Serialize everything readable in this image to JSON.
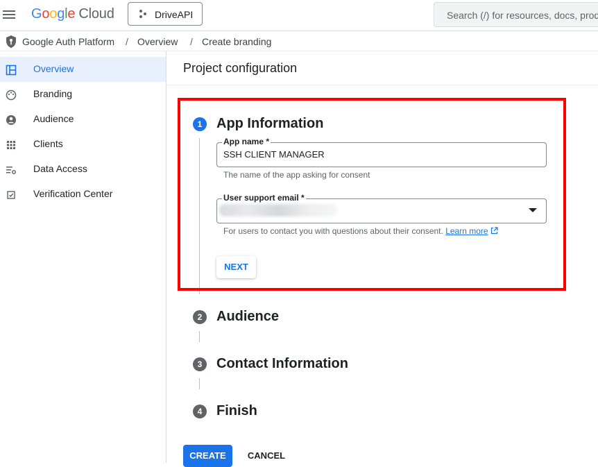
{
  "header": {
    "logo_google": [
      "G",
      "o",
      "o",
      "g",
      "l",
      "e"
    ],
    "logo_cloud": "Cloud",
    "project_name": "DriveAPI",
    "search_placeholder": "Search (/) for resources, docs, products"
  },
  "breadcrumb": [
    "Google Auth Platform",
    "Overview",
    "Create branding"
  ],
  "sidebar": {
    "items": [
      {
        "label": "Overview",
        "icon": "dashboard-icon",
        "active": true
      },
      {
        "label": "Branding",
        "icon": "palette-icon",
        "active": false
      },
      {
        "label": "Audience",
        "icon": "person-icon",
        "active": false
      },
      {
        "label": "Clients",
        "icon": "grid-icon",
        "active": false
      },
      {
        "label": "Data Access",
        "icon": "list-settings-icon",
        "active": false
      },
      {
        "label": "Verification Center",
        "icon": "checkbox-icon",
        "active": false
      }
    ]
  },
  "main": {
    "title": "Project configuration",
    "steps": [
      {
        "number": "1",
        "title": "App Information"
      },
      {
        "number": "2",
        "title": "Audience"
      },
      {
        "number": "3",
        "title": "Contact Information"
      },
      {
        "number": "4",
        "title": "Finish"
      }
    ],
    "app_name": {
      "label": "App name *",
      "value": "SSH CLIENT MANAGER",
      "hint": "The name of the app asking for consent"
    },
    "support_email": {
      "label": "User support email *",
      "hint": "For users to contact you with questions about their consent.",
      "learn_more": "Learn more"
    },
    "next_label": "NEXT",
    "create_label": "CREATE",
    "cancel_label": "CANCEL"
  },
  "colors": {
    "accent": "#1a73e8",
    "highlight_border": "#ff0000"
  }
}
